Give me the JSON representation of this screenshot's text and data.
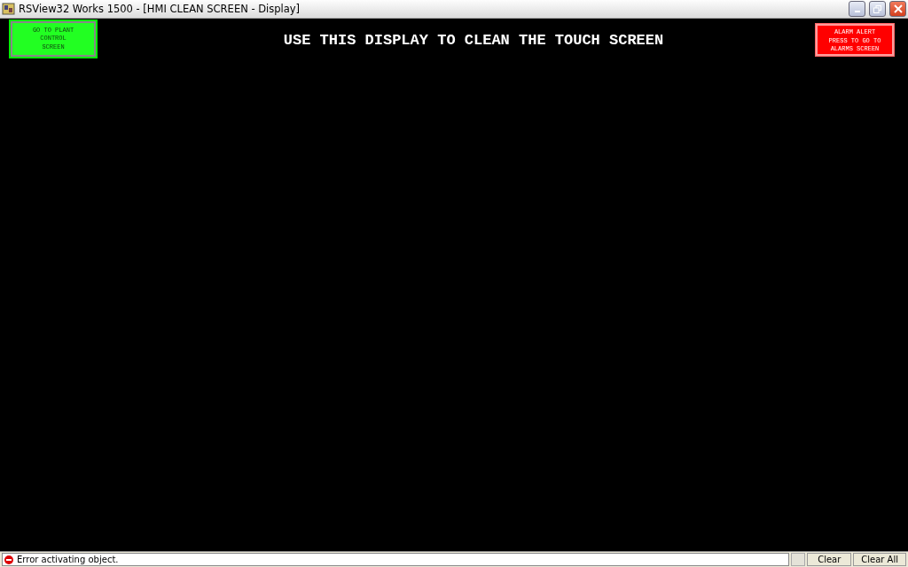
{
  "window": {
    "title": "RSView32 Works 1500 - [HMI CLEAN SCREEN - Display]"
  },
  "display": {
    "heading": "USE THIS DISPLAY TO CLEAN THE TOUCH SCREEN",
    "buttons": [
      {
        "kind": "nav",
        "lines": [
          "GO TO PLANT",
          "CONTROL",
          "SCREEN"
        ]
      },
      {
        "kind": "alarm",
        "lines": [
          "ALARM ALERT",
          "PRESS TO GO TO",
          "ALARMS SCREEN"
        ]
      }
    ]
  },
  "status_bar": {
    "message": "Error activating object.",
    "buttons": [
      "Clear",
      "Clear All"
    ]
  }
}
